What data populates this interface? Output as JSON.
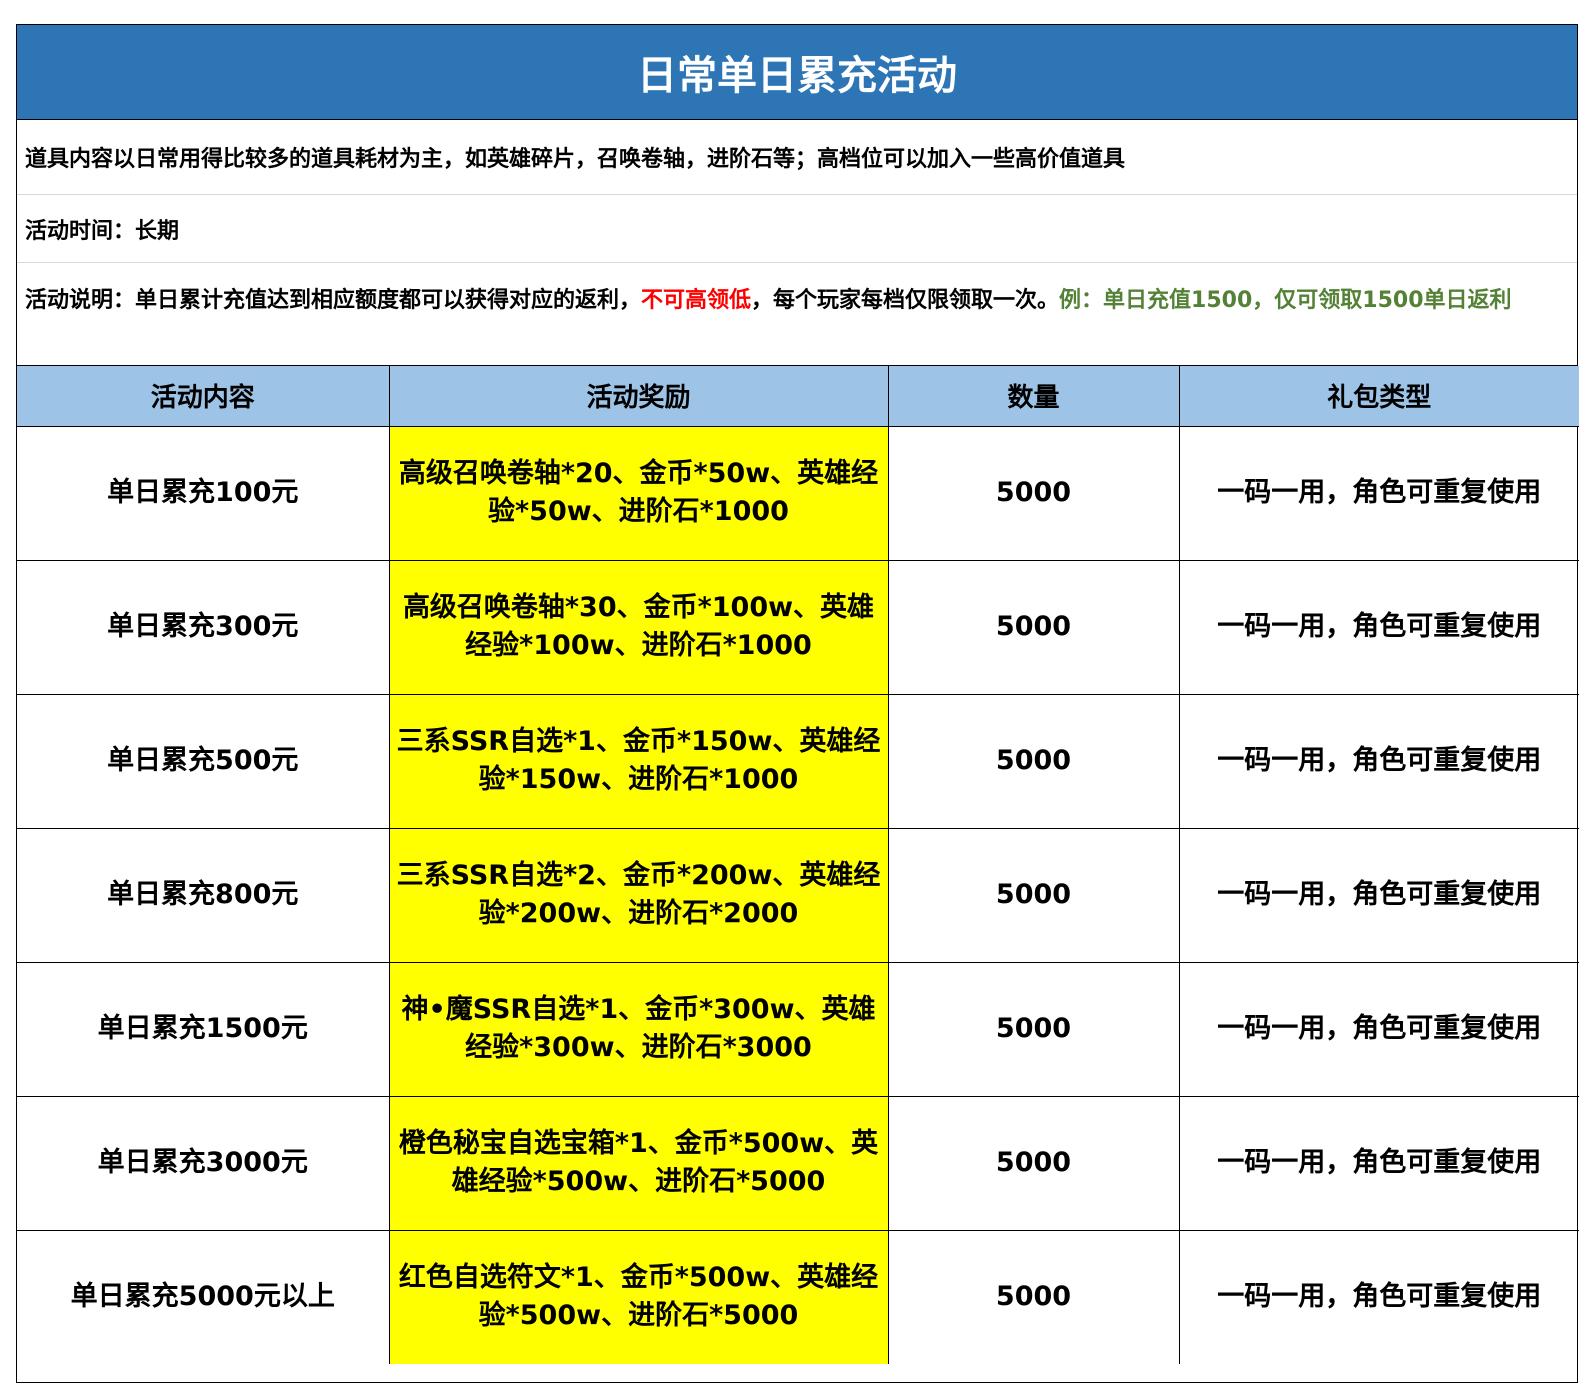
{
  "title": "日常单日累充活动",
  "notes": {
    "description": "道具内容以日常用得比较多的道具耗材为主，如英雄碎片，召唤卷轴，进阶石等；高档位可以加入一些高价值道具",
    "time": "活动时间：长期",
    "explain_prefix": "活动说明：单日累计充值达到相应额度都可以获得对应的返利，",
    "explain_red": "不可高领低",
    "explain_mid": "，每个玩家每档仅限领取一次。",
    "explain_green": "例：单日充值1500，仅可领取1500单日返利"
  },
  "colors": {
    "title_bg": "#2e75b6",
    "header_bg": "#9dc3e6",
    "reward_bg": "#ffff00",
    "red_text": "#ff0000",
    "green_text": "#538135"
  },
  "table": {
    "headers": [
      "活动内容",
      "活动奖励",
      "数量",
      "礼包类型"
    ],
    "rows": [
      {
        "content": "单日累充100元",
        "reward": "高级召唤卷轴*20、金币*50w、英雄经验*50w、进阶石*1000",
        "qty": "5000",
        "type": "一码一用，角色可重复使用"
      },
      {
        "content": "单日累充300元",
        "reward": "高级召唤卷轴*30、金币*100w、英雄经验*100w、进阶石*1000",
        "qty": "5000",
        "type": "一码一用，角色可重复使用"
      },
      {
        "content": "单日累充500元",
        "reward": "三系SSR自选*1、金币*150w、英雄经验*150w、进阶石*1000",
        "qty": "5000",
        "type": "一码一用，角色可重复使用"
      },
      {
        "content": "单日累充800元",
        "reward": "三系SSR自选*2、金币*200w、英雄经验*200w、进阶石*2000",
        "qty": "5000",
        "type": "一码一用，角色可重复使用"
      },
      {
        "content": "单日累充1500元",
        "reward": "神•魔SSR自选*1、金币*300w、英雄经验*300w、进阶石*3000",
        "qty": "5000",
        "type": "一码一用，角色可重复使用"
      },
      {
        "content": "单日累充3000元",
        "reward": "橙色秘宝自选宝箱*1、金币*500w、英雄经验*500w、进阶石*5000",
        "qty": "5000",
        "type": "一码一用，角色可重复使用"
      },
      {
        "content": "单日累充5000元以上",
        "reward": "红色自选符文*1、金币*500w、英雄经验*500w、进阶石*5000",
        "qty": "5000",
        "type": "一码一用，角色可重复使用"
      }
    ]
  }
}
